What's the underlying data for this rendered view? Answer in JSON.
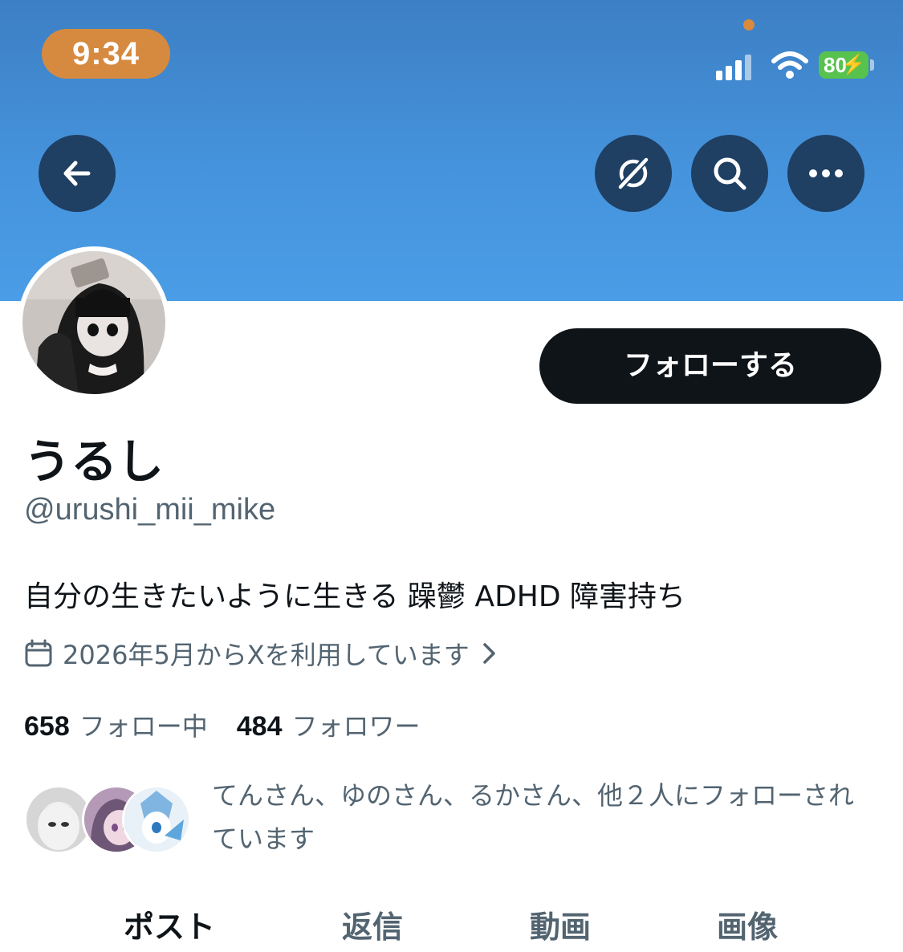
{
  "status_bar": {
    "time": "9:34",
    "battery": "80",
    "icons": [
      "signal-icon",
      "wifi-icon",
      "battery-icon"
    ]
  },
  "header": {
    "buttons": [
      "back-arrow-icon",
      "grok-icon",
      "search-icon",
      "more-icon"
    ],
    "banner_color": "#4593dc"
  },
  "profile": {
    "follow_label": "フォローする",
    "display_name": "うるし",
    "handle": "@urushi_mii_mike",
    "bio": "自分の生きたいように生きる 躁鬱 ADHD 障害持ち",
    "joined": "2026年5月からXを利用しています"
  },
  "stats": {
    "following_count": "658",
    "following_label": "フォロー中",
    "followers_count": "484",
    "followers_label": "フォロワー"
  },
  "followed_by": {
    "text": "てんさん、ゆのさん、るかさん、他２人にフォローされています"
  },
  "tabs": [
    {
      "label": "ポスト",
      "active": true
    },
    {
      "label": "返信",
      "active": false
    },
    {
      "label": "動画",
      "active": false
    },
    {
      "label": "画像",
      "active": false
    }
  ],
  "colors": {
    "text": "#0f1419",
    "secondary_text": "#536471",
    "button_bg": "#1f3f63",
    "time_pill": "#d68a3f",
    "battery": "#58c24f"
  }
}
